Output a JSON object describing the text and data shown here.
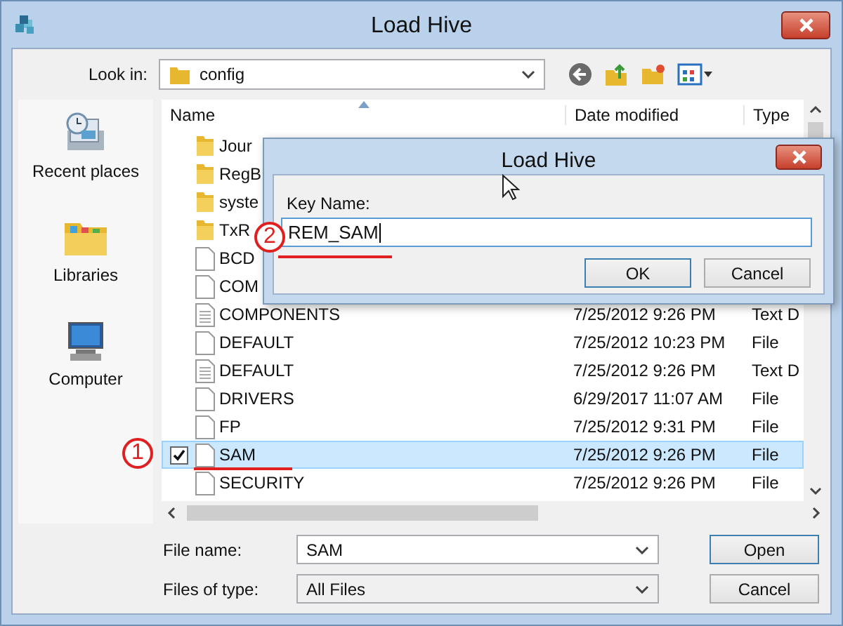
{
  "window": {
    "title": "Load Hive"
  },
  "look_in": {
    "label": "Look in:",
    "value": "config"
  },
  "places": [
    {
      "label": "Recent places",
      "kind": "recent"
    },
    {
      "label": "Libraries",
      "kind": "libraries"
    },
    {
      "label": "Computer",
      "kind": "computer"
    }
  ],
  "columns": [
    "Name",
    "Date modified",
    "Type"
  ],
  "rows": [
    {
      "name": "Jour",
      "kind": "folder",
      "selected": false,
      "checked": false
    },
    {
      "name": "RegB",
      "kind": "folder",
      "selected": false,
      "checked": false
    },
    {
      "name": "syste",
      "kind": "folder",
      "selected": false,
      "checked": false
    },
    {
      "name": "TxR",
      "kind": "folder",
      "selected": false,
      "checked": false
    },
    {
      "name": "BCD",
      "kind": "file",
      "selected": false,
      "checked": false
    },
    {
      "name": "COM",
      "kind": "file",
      "selected": false,
      "checked": false
    },
    {
      "name": "COMPONENTS",
      "kind": "text",
      "date": "7/25/2012 9:26 PM",
      "type": "Text D",
      "selected": false,
      "checked": false
    },
    {
      "name": "DEFAULT",
      "kind": "file",
      "date": "7/25/2012 10:23 PM",
      "type": "File",
      "selected": false,
      "checked": false
    },
    {
      "name": "DEFAULT",
      "kind": "text",
      "date": "7/25/2012 9:26 PM",
      "type": "Text D",
      "selected": false,
      "checked": false
    },
    {
      "name": "DRIVERS",
      "kind": "file",
      "date": "6/29/2017 11:07 AM",
      "type": "File",
      "selected": false,
      "checked": false
    },
    {
      "name": "FP",
      "kind": "file",
      "date": "7/25/2012 9:31 PM",
      "type": "File",
      "selected": false,
      "checked": false
    },
    {
      "name": "SAM",
      "kind": "file",
      "date": "7/25/2012 9:26 PM",
      "type": "File",
      "selected": true,
      "checked": true
    },
    {
      "name": "SECURITY",
      "kind": "file",
      "date": "7/25/2012 9:26 PM",
      "type": "File",
      "selected": false,
      "checked": false
    }
  ],
  "file_name": {
    "label": "File name:",
    "value": "SAM"
  },
  "file_type": {
    "label": "Files of type:",
    "value": "All Files"
  },
  "buttons": [
    "Open",
    "Cancel"
  ],
  "dialog": {
    "title": "Load Hive",
    "label": "Key Name:",
    "value": "REM_SAM",
    "buttons": [
      "OK",
      "Cancel"
    ]
  },
  "annotations": [
    "1",
    "2"
  ]
}
